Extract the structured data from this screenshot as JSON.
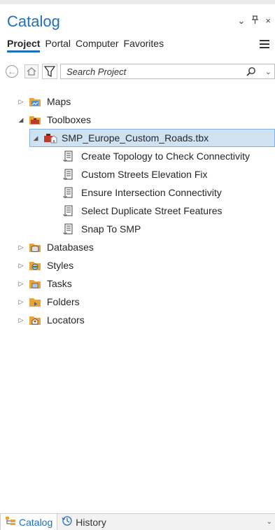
{
  "panel": {
    "title": "Catalog",
    "ctrl_menu": "⌄",
    "ctrl_pin": "ᵽ",
    "ctrl_close": "×"
  },
  "tabs": [
    {
      "label": "Project",
      "active": true
    },
    {
      "label": "Portal",
      "active": false
    },
    {
      "label": "Computer",
      "active": false
    },
    {
      "label": "Favorites",
      "active": false
    }
  ],
  "search": {
    "placeholder": "Search Project",
    "chevron": "⌄"
  },
  "tree": {
    "maps": "Maps",
    "toolboxes": "Toolboxes",
    "toolbox_file": "SMP_Europe_Custom_Roads.tbx",
    "tools": [
      "Create Topology to Check Connectivity",
      "Custom Streets Elevation Fix",
      "Ensure Intersection Connectivity",
      "Select Duplicate Street Features",
      "Snap To SMP"
    ],
    "databases": "Databases",
    "styles": "Styles",
    "tasks": "Tasks",
    "folders": "Folders",
    "locators": "Locators"
  },
  "bottom_tabs": [
    {
      "label": "Catalog",
      "active": true
    },
    {
      "label": "History",
      "active": false
    }
  ],
  "colors": {
    "accent": "#1f6fbf",
    "selected_row": "#cfe2f2",
    "folder": "#e8a33a"
  }
}
